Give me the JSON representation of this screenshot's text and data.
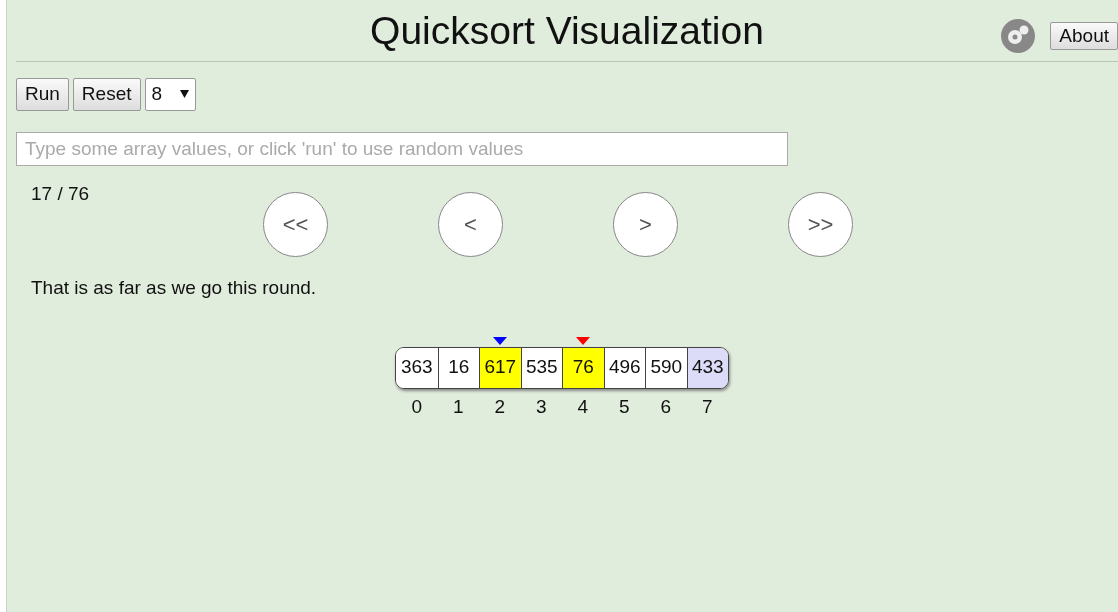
{
  "title": "Quicksort Visualization",
  "about_button": "About",
  "controls": {
    "run": "Run",
    "reset": "Reset",
    "size": "8"
  },
  "input": {
    "placeholder": "Type some array values, or click 'run' to use random values"
  },
  "step": "17 / 76",
  "nav_buttons": [
    "<<",
    "<",
    ">",
    ">>"
  ],
  "message": "That is as far as we go this round.",
  "cells": [
    {
      "value": "363",
      "index": "0"
    },
    {
      "value": "16",
      "index": "1"
    },
    {
      "value": "617",
      "index": "2",
      "color": "#ffff00",
      "marker": {
        "color": "#0000ff"
      }
    },
    {
      "value": "535",
      "index": "3"
    },
    {
      "value": "76",
      "index": "4",
      "color": "#ffff00",
      "marker": {
        "color": "#ff0000"
      }
    },
    {
      "value": "496",
      "index": "5"
    },
    {
      "value": "590",
      "index": "6"
    },
    {
      "value": "433",
      "index": "7",
      "color": "#dcdcf8"
    }
  ]
}
